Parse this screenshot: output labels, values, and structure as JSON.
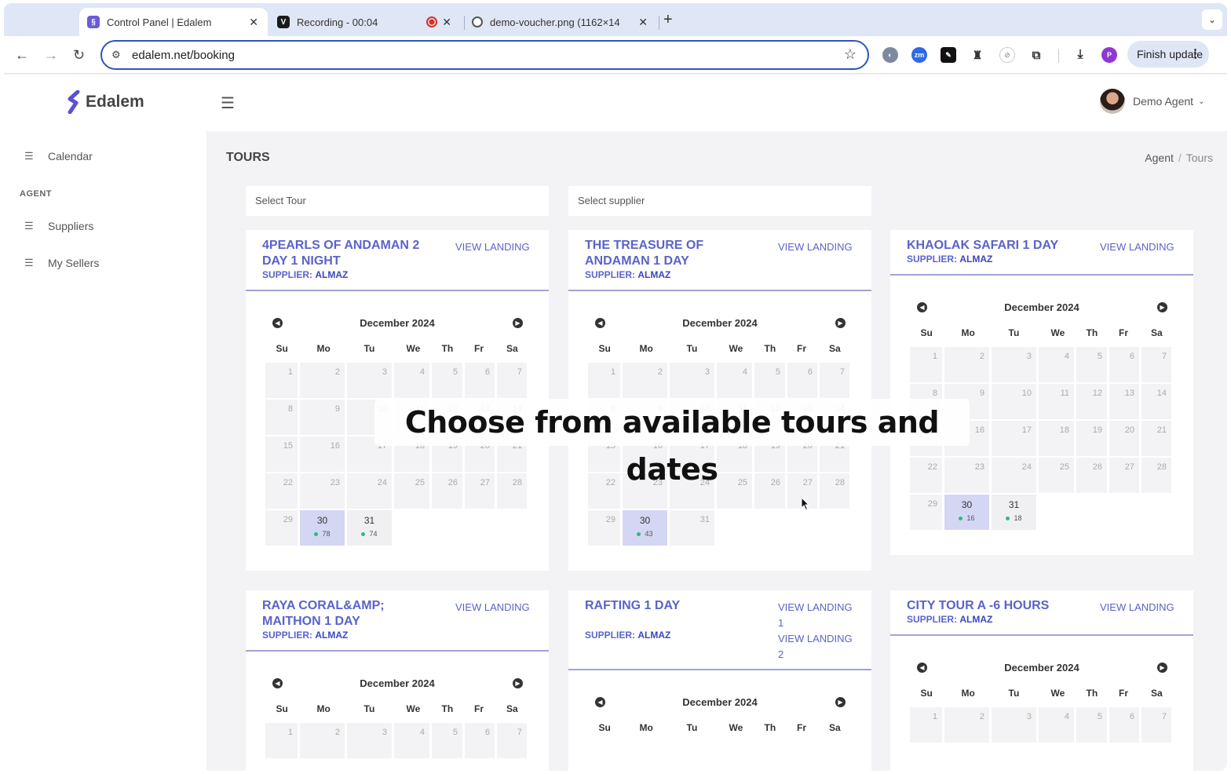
{
  "browser": {
    "tabs": [
      {
        "title": "Control Panel | Edalem",
        "close": "✕"
      },
      {
        "title": "Recording - 00:04",
        "close": "✕"
      },
      {
        "title": "demo-voucher.png (1162×14",
        "close": "✕"
      }
    ],
    "new_tab": "+",
    "url": "edalem.net/booking",
    "finish_update": "Finish update"
  },
  "app": {
    "logo_text": "Edalem",
    "user_name": "Demo Agent",
    "sidebar": {
      "calendar": "Calendar",
      "section": "AGENT",
      "suppliers": "Suppliers",
      "sellers": "My Sellers"
    },
    "page_title": "TOURS",
    "breadcrumb": {
      "first": "Agent",
      "sep": "/",
      "last": "Tours"
    },
    "select_tour": "Select Tour",
    "select_supplier": "Select supplier",
    "supplier_label": "SUPPLIER:",
    "month": "December 2024",
    "days": [
      "Su",
      "Mo",
      "Tu",
      "We",
      "Th",
      "Fr",
      "Sa"
    ],
    "cards": [
      {
        "title": "4PEARLS OF ANDAMAN 2 DAY 1 NIGHT",
        "supplier": "ALMAZ",
        "links": [
          "VIEW LANDING"
        ],
        "availability": {
          "30": 78,
          "31": 74
        }
      },
      {
        "title": "THE TREASURE OF ANDAMAN 1 DAY",
        "supplier": "ALMAZ",
        "links": [
          "VIEW LANDING"
        ],
        "availability": {
          "30": 43
        }
      },
      {
        "title": "KHAOLAK SAFARI 1 DAY",
        "supplier": "ALMAZ",
        "links": [
          "VIEW LANDING"
        ],
        "availability": {
          "30": 16,
          "31": 18
        }
      },
      {
        "title": "RAYA CORAL&AMP; MAITHON 1 DAY",
        "supplier": "ALMAZ",
        "links": [
          "VIEW LANDING"
        ],
        "availability": {}
      },
      {
        "title": "RAFTING 1 DAY",
        "supplier": "ALMAZ",
        "links": [
          "VIEW LANDING 1",
          "VIEW LANDING 2"
        ],
        "availability": {}
      },
      {
        "title": "CITY TOUR A -6 HOURS",
        "supplier": "ALMAZ",
        "links": [
          "VIEW LANDING"
        ],
        "availability": {}
      }
    ]
  },
  "overlay_caption": "Choose from available tours and dates",
  "colors": {
    "accent": "#5a63c9",
    "selected": "#d4d7f3",
    "available_dot": "#31b97b",
    "address_border": "#2e56b8"
  }
}
